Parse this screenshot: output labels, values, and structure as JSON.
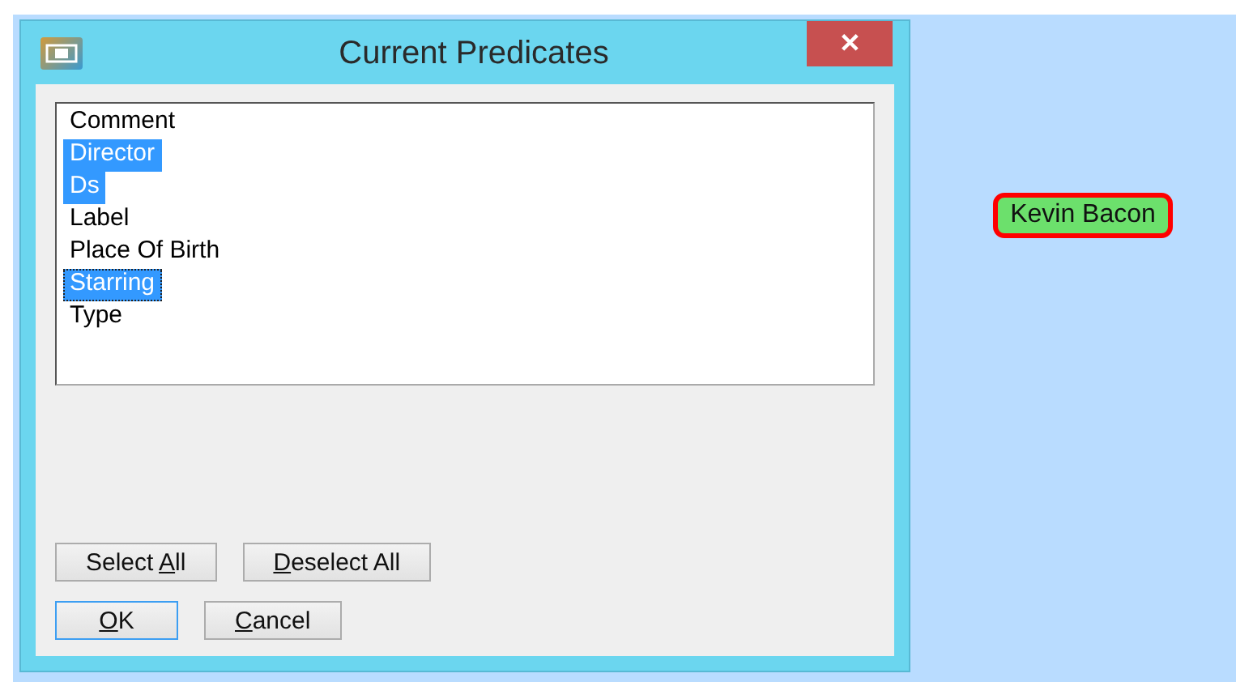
{
  "window": {
    "title": "Current Predicates",
    "close": "✕"
  },
  "list": [
    {
      "label": "Comment",
      "selected": false,
      "focused": false
    },
    {
      "label": "Director",
      "selected": true,
      "focused": false
    },
    {
      "label": "Ds",
      "selected": true,
      "focused": false
    },
    {
      "label": "Label",
      "selected": false,
      "focused": false
    },
    {
      "label": "Place Of Birth",
      "selected": false,
      "focused": false
    },
    {
      "label": "Starring",
      "selected": true,
      "focused": true
    },
    {
      "label": "Type",
      "selected": false,
      "focused": false
    }
  ],
  "selection_buttons": [
    {
      "before": "Select ",
      "access_key": "A",
      "after": "ll",
      "default": false
    },
    {
      "access_key": "D",
      "after": "eselect All",
      "default": false
    }
  ],
  "dialog_buttons": [
    {
      "access_key": "O",
      "after": "K",
      "default": true
    },
    {
      "access_key": "C",
      "after": "ancel",
      "default": false
    }
  ],
  "node": {
    "label": "Kevin Bacon"
  }
}
